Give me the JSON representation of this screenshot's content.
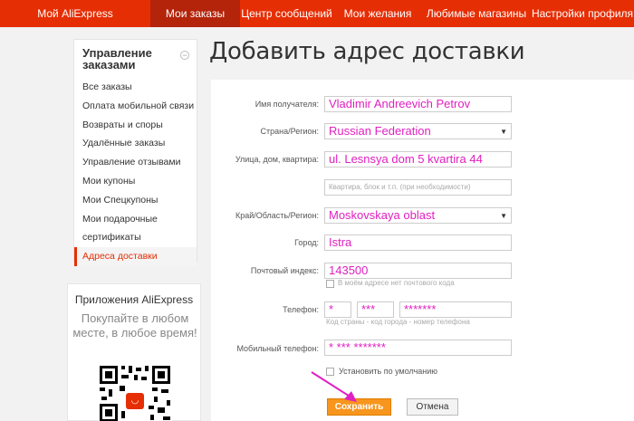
{
  "nav": {
    "items": [
      {
        "label": "Мой AliExpress",
        "active": false
      },
      {
        "label": "Мои заказы",
        "active": true
      },
      {
        "label": "Центр сообщений",
        "active": false
      },
      {
        "label": "Мои желания",
        "active": false
      },
      {
        "label": "Любимые магазины",
        "active": false
      },
      {
        "label": "Настройки профиля",
        "active": false
      }
    ]
  },
  "sidebar": {
    "title": "Управление заказами",
    "collapse_symbol": "−",
    "items": [
      {
        "label": "Все заказы"
      },
      {
        "label": "Оплата мобильной связи"
      },
      {
        "label": "Возвраты и споры"
      },
      {
        "label": "Удалённые заказы"
      },
      {
        "label": "Управление отзывами"
      },
      {
        "label": "Мои купоны"
      },
      {
        "label": "Мои Спецкупоны"
      },
      {
        "label": "Мои подарочные"
      },
      {
        "label": "сертификаты"
      },
      {
        "label": "Адреса доставки",
        "active": true
      }
    ]
  },
  "promo": {
    "title": "Приложения AliExpress",
    "text": "Покупайте в любом месте, в любое время!"
  },
  "page": {
    "title": "Добавить адрес доставки"
  },
  "form": {
    "recipient_label": "Имя получателя:",
    "recipient_value": "Vladimir Andreevich Petrov",
    "country_label": "Страна/Регион:",
    "country_value": "Russian Federation",
    "street_label": "Улица, дом, квартира:",
    "street_value": "ul. Lesnsya dom 5 kvartira 44",
    "apartment_placeholder": "Квартира, блок и т.п. (при необходимости)",
    "region_label": "Край/Область/Регион:",
    "region_value": "Moskovskaya oblast",
    "city_label": "Город:",
    "city_value": "Istra",
    "zip_label": "Почтовый индекс:",
    "zip_value": "143500",
    "no_zip_label": "В моём адресе нет почтового кода",
    "phone_label": "Телефон:",
    "phone_country": "*",
    "phone_city": "***",
    "phone_number": "*******",
    "phone_hint": "Код страны - код города - номер телефона",
    "mobile_label": "Мобильный телефон:",
    "mobile_value": "* *** *******",
    "default_label": "Установить по умолчанию",
    "save_label": "Сохранить",
    "cancel_label": "Отмена"
  },
  "colors": {
    "nav_bg": "#e62e04",
    "nav_active": "#b3240b",
    "save_btn": "#f7951d",
    "annotation": "#e020c0"
  }
}
